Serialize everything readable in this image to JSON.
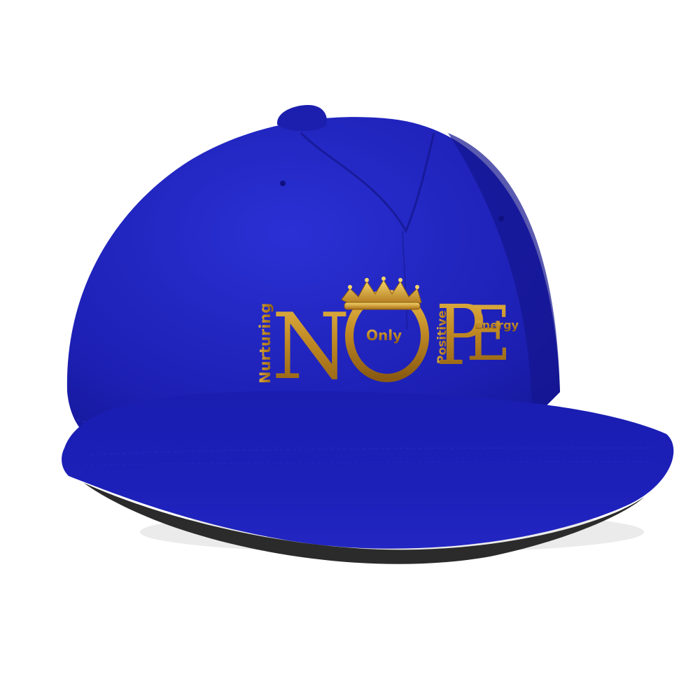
{
  "product": {
    "type": "snapback cap",
    "cap_color": "#1b1eb0",
    "print_color": "#c8922a"
  },
  "logo": {
    "big_letters": [
      "N",
      "O",
      "P",
      "E"
    ],
    "small_words": {
      "n": "Nurturing",
      "o": "Only",
      "p": "Positive",
      "e": "Energy"
    },
    "ornament": "crown-icon"
  }
}
